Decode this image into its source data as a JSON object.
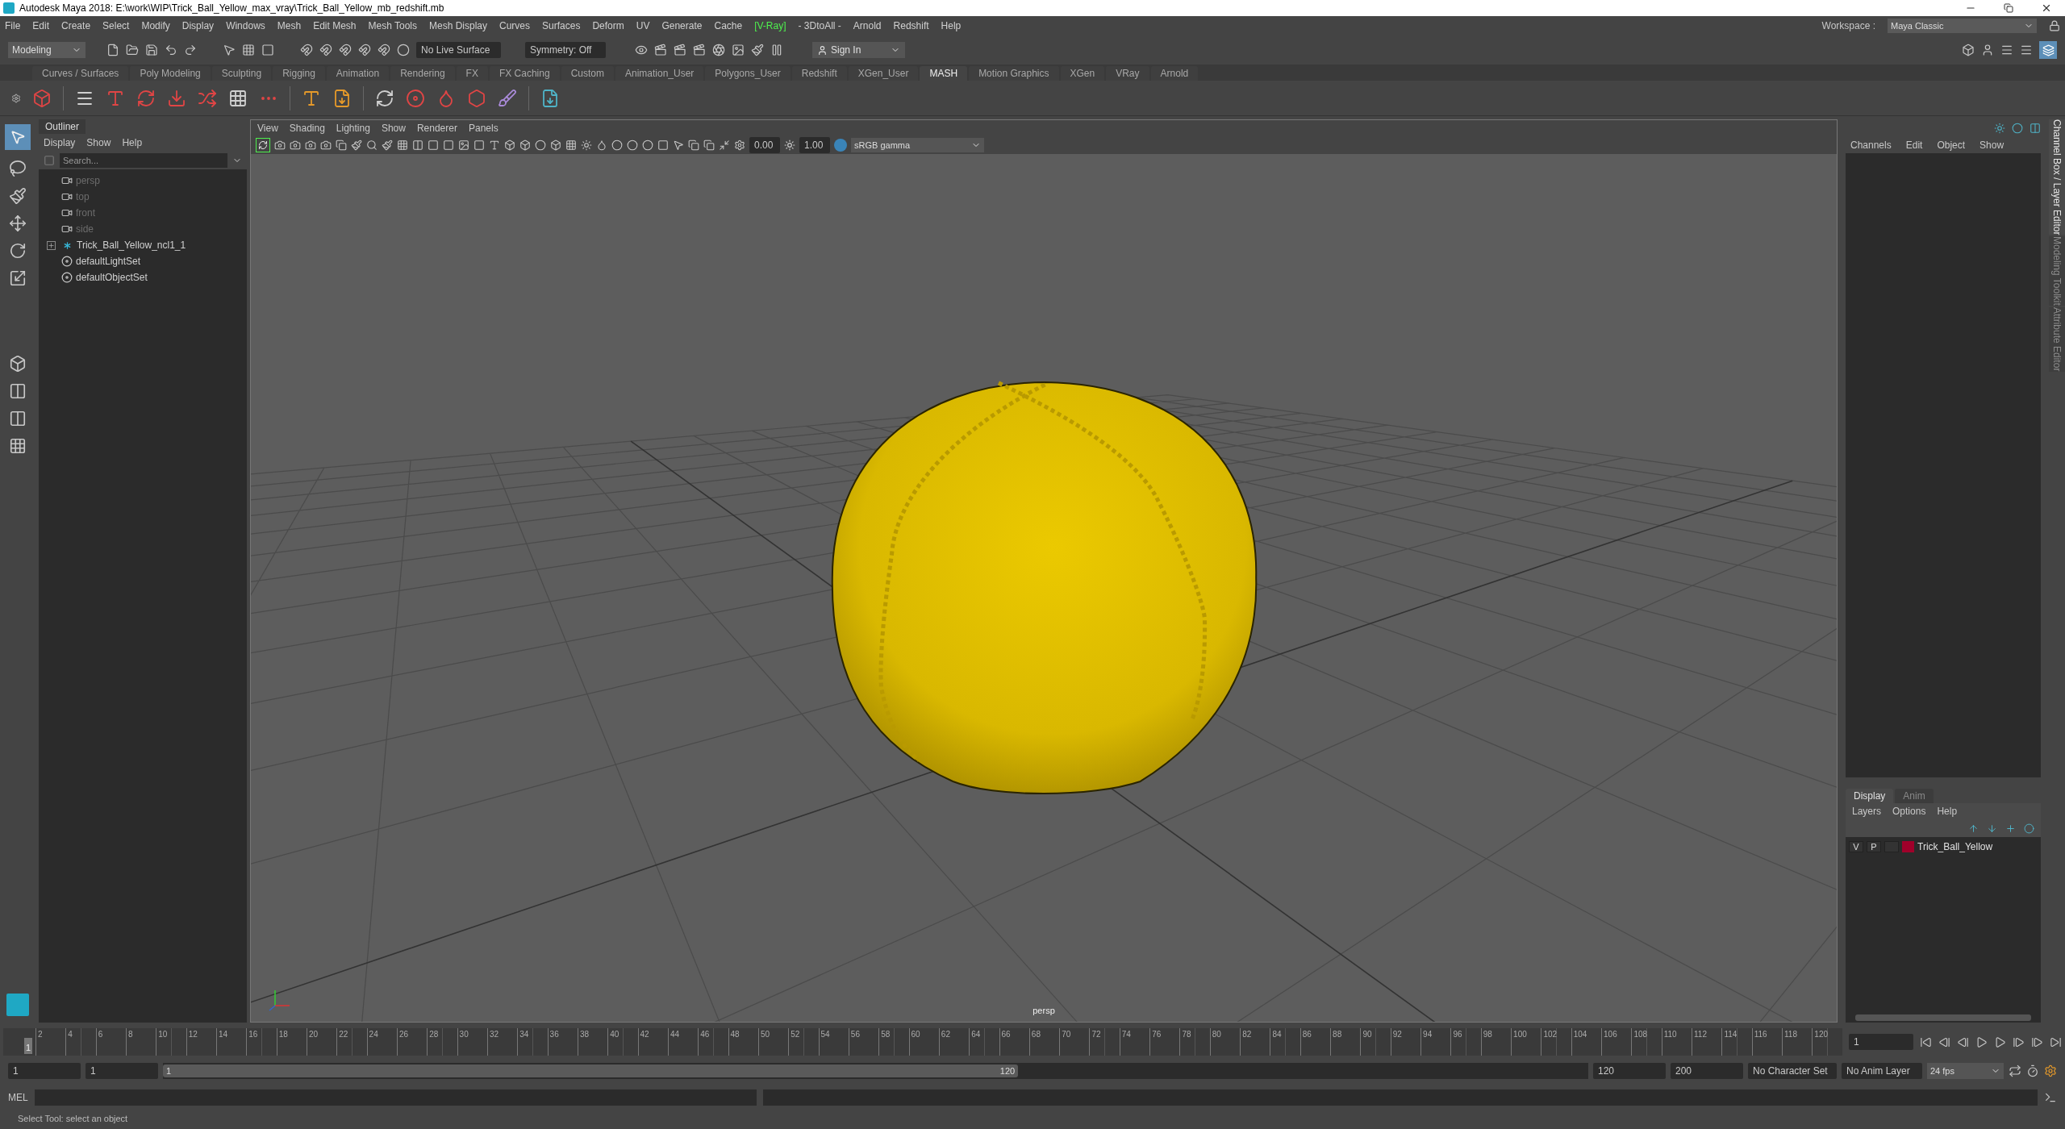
{
  "window": {
    "title": "Autodesk Maya 2018: E:\\work\\WIP\\Trick_Ball_Yellow_max_vray\\Trick_Ball_Yellow_mb_redshift.mb"
  },
  "menu_bar": [
    {
      "label": "File",
      "kind": "plain"
    },
    {
      "label": "Edit",
      "kind": "plain"
    },
    {
      "label": "Create",
      "kind": "plain"
    },
    {
      "label": "Select",
      "kind": "plain"
    },
    {
      "label": "Modify",
      "kind": "plain"
    },
    {
      "label": "Display",
      "kind": "plain"
    },
    {
      "label": "Windows",
      "kind": "plain"
    },
    {
      "label": "Mesh",
      "kind": "plain"
    },
    {
      "label": "Edit Mesh",
      "kind": "plain"
    },
    {
      "label": "Mesh Tools",
      "kind": "plain"
    },
    {
      "label": "Mesh Display",
      "kind": "plain"
    },
    {
      "label": "Curves",
      "kind": "plain"
    },
    {
      "label": "Surfaces",
      "kind": "plain"
    },
    {
      "label": "Deform",
      "kind": "plain"
    },
    {
      "label": "UV",
      "kind": "plain"
    },
    {
      "label": "Generate",
      "kind": "plain"
    },
    {
      "label": "Cache",
      "kind": "plain"
    },
    {
      "label": "[V-Ray]",
      "kind": "plugin"
    },
    {
      "label": "- 3DtoAll -",
      "kind": "plain"
    },
    {
      "label": "Arnold",
      "kind": "plain"
    },
    {
      "label": "Redshift",
      "kind": "plain"
    },
    {
      "label": "Help",
      "kind": "plain"
    }
  ],
  "workspace": {
    "label": "Workspace :",
    "value": "Maya Classic"
  },
  "status_line": {
    "mode": "Modeling",
    "live_surface": "No Live Surface",
    "symmetry": "Symmetry: Off",
    "sign_in": "Sign In"
  },
  "shelf_tabs": [
    {
      "label": "Curves / Surfaces",
      "selected": false
    },
    {
      "label": "Poly Modeling",
      "selected": false
    },
    {
      "label": "Sculpting",
      "selected": false
    },
    {
      "label": "Rigging",
      "selected": false
    },
    {
      "label": "Animation",
      "selected": false
    },
    {
      "label": "Rendering",
      "selected": false
    },
    {
      "label": "FX",
      "selected": false
    },
    {
      "label": "FX Caching",
      "selected": false
    },
    {
      "label": "Custom",
      "selected": false
    },
    {
      "label": "Animation_User",
      "selected": false
    },
    {
      "label": "Polygons_User",
      "selected": false
    },
    {
      "label": "Redshift",
      "selected": false
    },
    {
      "label": "XGen_User",
      "selected": false
    },
    {
      "label": "MASH",
      "selected": true
    },
    {
      "label": "Motion Graphics",
      "selected": false
    },
    {
      "label": "XGen",
      "selected": false
    },
    {
      "label": "VRay",
      "selected": false
    },
    {
      "label": "Arnold",
      "selected": false
    }
  ],
  "outliner": {
    "title": "Outliner",
    "menu": [
      "Display",
      "Show",
      "Help"
    ],
    "search": {
      "placeholder": "Search..."
    },
    "items": [
      {
        "label": "persp",
        "kind": "camera",
        "dimmed": true
      },
      {
        "label": "top",
        "kind": "camera",
        "dimmed": true
      },
      {
        "label": "front",
        "kind": "camera",
        "dimmed": true
      },
      {
        "label": "side",
        "kind": "camera",
        "dimmed": true
      },
      {
        "label": "Trick_Ball_Yellow_ncl1_1",
        "kind": "group",
        "dimmed": false,
        "expanded": false
      },
      {
        "label": "defaultLightSet",
        "kind": "set",
        "dimmed": false
      },
      {
        "label": "defaultObjectSet",
        "kind": "set",
        "dimmed": false
      }
    ]
  },
  "viewport": {
    "menu": [
      "View",
      "Shading",
      "Lighting",
      "Show",
      "Renderer",
      "Panels"
    ],
    "exposure": "0.00",
    "gamma": "1.00",
    "color_space": "sRGB gamma",
    "camera": "persp"
  },
  "channel_box": {
    "menu": [
      "Channels",
      "Edit",
      "Object",
      "Show"
    ]
  },
  "layer_editor": {
    "tabs": [
      {
        "label": "Display",
        "selected": true
      },
      {
        "label": "Anim",
        "selected": false
      }
    ],
    "menu": [
      "Layers",
      "Options",
      "Help"
    ],
    "layers": [
      {
        "visibility": "V",
        "playback": "P",
        "color": "#a0002a",
        "name": "Trick_Ball_Yellow"
      }
    ]
  },
  "side_tabs": [
    {
      "label": "Channel Box / Layer Editor",
      "selected": true
    },
    {
      "label": "Modeling Toolkit",
      "selected": false
    },
    {
      "label": "Attribute Editor",
      "selected": false
    }
  ],
  "time_slider": {
    "current_frame": "1",
    "level": 0,
    "ticks": [
      "2",
      "4",
      "6",
      "8",
      "10",
      "12",
      "14",
      "16",
      "18",
      "20",
      "22",
      "24",
      "26",
      "28",
      "30",
      "32",
      "34",
      "36",
      "38",
      "40",
      "42",
      "44",
      "46",
      "48",
      "50",
      "52",
      "54",
      "56",
      "58",
      "60",
      "62",
      "64",
      "66",
      "68",
      "70",
      "72",
      "74",
      "76",
      "78",
      "80",
      "82",
      "84",
      "86",
      "88",
      "90",
      "92",
      "94",
      "96",
      "98",
      "100",
      "102",
      "104",
      "106",
      "108",
      "110",
      "112",
      "114",
      "116",
      "118",
      "120"
    ],
    "frame_field": "1"
  },
  "range": {
    "level": 0.6,
    "start": "1",
    "playback_start": "1",
    "slider_start": "1",
    "slider_end": "120",
    "playback_end": "120",
    "end": "200",
    "character_set": "No Character Set",
    "anim_layer": "No Anim Layer",
    "fps": "24 fps"
  },
  "command_line": {
    "label": "MEL"
  },
  "help_line": "Select Tool: select an object"
}
